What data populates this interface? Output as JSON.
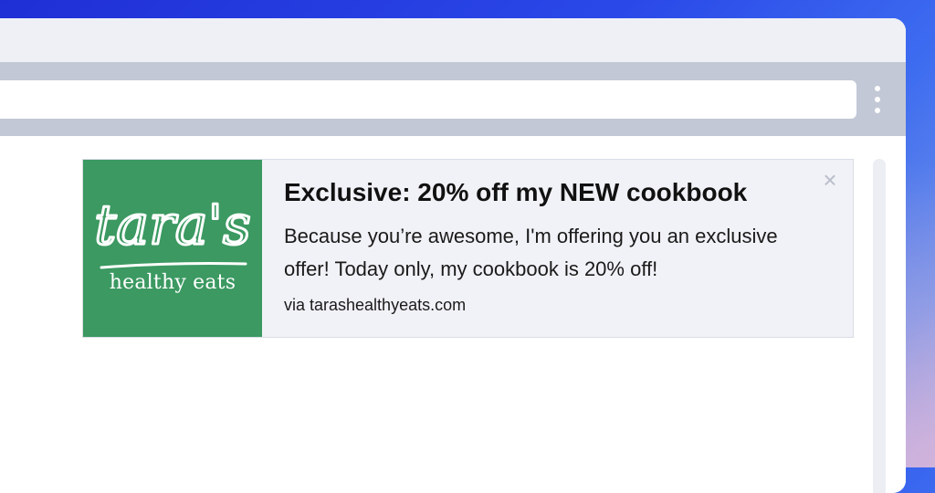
{
  "browser": {
    "menu_icon": "kebab-menu-icon"
  },
  "notification": {
    "logo": {
      "script_text": "tara's",
      "subtitle": "healthy eats",
      "background_color": "#3b9961"
    },
    "title": "Exclusive: 20% off my NEW cookbook",
    "body": "Because you’re awesome, I'm offering you an exclusive offer! Today only, my cookbook is 20% off!",
    "source": "via tarashealthyeats.com",
    "close_icon": "close-icon"
  }
}
